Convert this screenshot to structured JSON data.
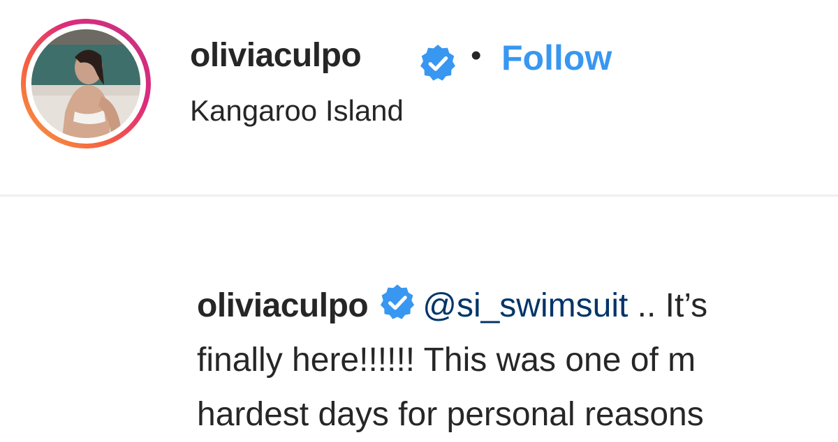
{
  "post": {
    "header": {
      "username": "oliviaculpo",
      "verified_icon": "verified-badge-icon",
      "separator": "•",
      "follow_label": "Follow",
      "location": "Kangaroo Island"
    },
    "caption": {
      "username": "oliviaculpo",
      "mention": "@si_swimsuit",
      "line1_text": " .. It’s",
      "line2_text": "finally here!!!!!! This was one of m",
      "line3_text": "hardest days for personal reasons"
    }
  },
  "colors": {
    "follow_blue": "#3897f0",
    "mention_blue": "#003569",
    "verified_blue": "#3897f0",
    "text": "#262626",
    "divider": "#efefef"
  }
}
